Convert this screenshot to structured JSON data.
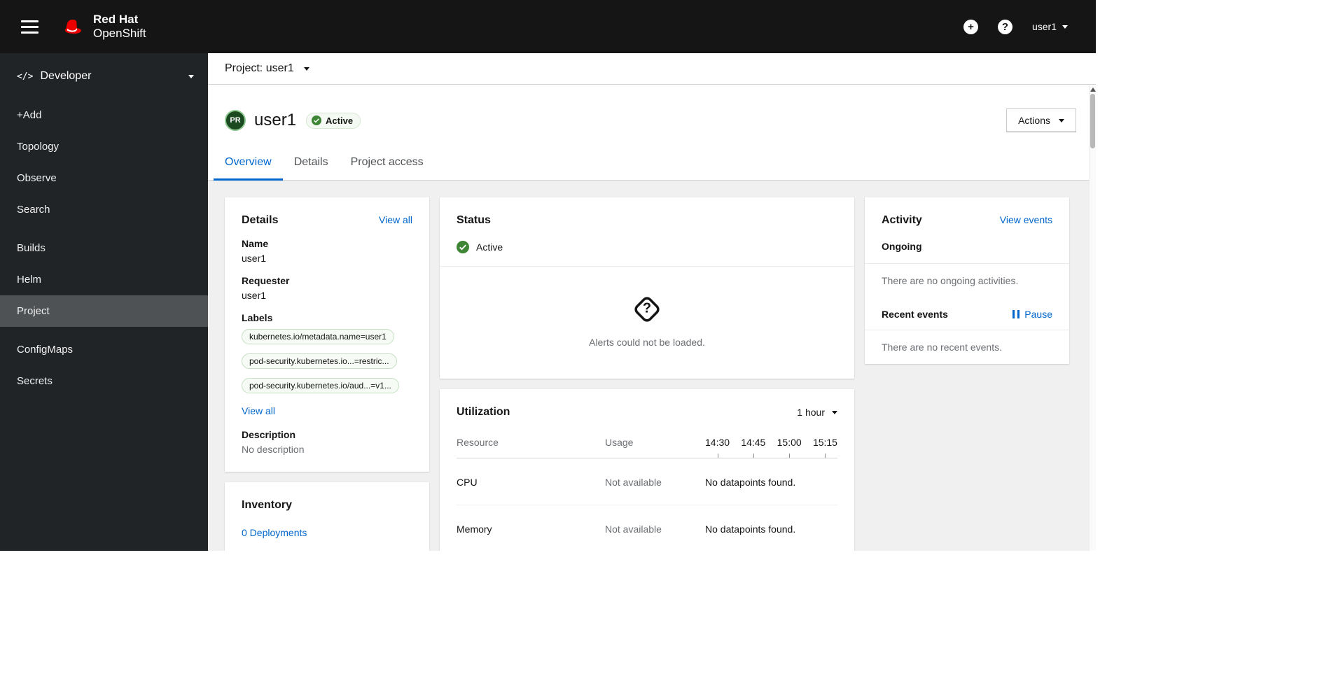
{
  "colors": {
    "accent": "#0066cc",
    "masthead_bg": "#151515",
    "status_green": "#3e8635",
    "active_tab": "#0066cc"
  },
  "icons": {
    "plus": "+",
    "help": "?",
    "question": "?",
    "perspective_code": "</>"
  },
  "masthead": {
    "brand_line1": "Red Hat",
    "brand_line2": "OpenShift",
    "user": "user1"
  },
  "sidebar": {
    "perspective": "Developer",
    "items": [
      {
        "label": "+Add"
      },
      {
        "label": "Topology"
      },
      {
        "label": "Observe"
      },
      {
        "label": "Search"
      },
      {
        "label": "Builds"
      },
      {
        "label": "Helm"
      },
      {
        "label": "Project"
      },
      {
        "label": "ConfigMaps"
      },
      {
        "label": "Secrets"
      }
    ]
  },
  "project_bar": {
    "label": "Project: user1"
  },
  "page": {
    "avatar": "PR",
    "title": "user1",
    "status": "Active",
    "actions": "Actions",
    "tabs": [
      {
        "label": "Overview"
      },
      {
        "label": "Details"
      },
      {
        "label": "Project access"
      }
    ]
  },
  "details_card": {
    "title": "Details",
    "view_all": "View all",
    "name_label": "Name",
    "name_value": "user1",
    "requester_label": "Requester",
    "requester_value": "user1",
    "labels_label": "Labels",
    "labels": [
      "kubernetes.io/metadata.name=user1",
      "pod-security.kubernetes.io...=restric...",
      "pod-security.kubernetes.io/aud...=v1..."
    ],
    "view_all_labels": "View all",
    "description_label": "Description",
    "description_value": "No description"
  },
  "inventory_card": {
    "title": "Inventory",
    "deployments_link": "0 Deployments"
  },
  "status_card": {
    "title": "Status",
    "status": "Active",
    "alerts_empty": "Alerts could not be loaded."
  },
  "utilization_card": {
    "title": "Utilization",
    "duration": "1 hour",
    "col_resource": "Resource",
    "col_usage": "Usage",
    "times": [
      "14:30",
      "14:45",
      "15:00",
      "15:15"
    ],
    "rows": [
      {
        "resource": "CPU",
        "usage": "Not available",
        "datapoints": "No datapoints found."
      },
      {
        "resource": "Memory",
        "usage": "Not available",
        "datapoints": "No datapoints found."
      }
    ]
  },
  "activity_card": {
    "title": "Activity",
    "view_events": "View events",
    "ongoing_label": "Ongoing",
    "ongoing_empty": "There are no ongoing activities.",
    "recent_label": "Recent events",
    "pause_label": "Pause",
    "recent_empty": "There are no recent events."
  }
}
